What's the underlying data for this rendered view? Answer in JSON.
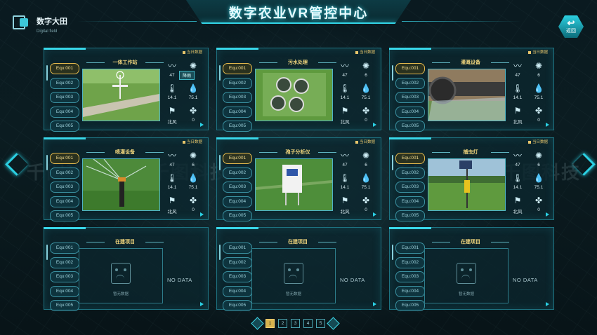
{
  "header": {
    "title": "数字农业VR管控中心",
    "brand_title": "数字大田",
    "brand_sub": "Digital field",
    "back_label": "返回"
  },
  "tooltip": "降雨",
  "panels": [
    {
      "title": "一体工作站",
      "tag": "当日数据",
      "photo": "weather-station",
      "equipment": [
        "Equ:001",
        "Equ:002",
        "Equ:003",
        "Equ:004",
        "Equ:005"
      ],
      "metrics": {
        "humidity": "47",
        "light": "6",
        "temperature": "14.1",
        "moisture": "75.1",
        "wind_direction": "北风",
        "wind_speed": "0"
      }
    },
    {
      "title": "污水处理",
      "tag": "当日数据",
      "photo": "sewage-plant",
      "equipment": [
        "Equ:001",
        "Equ:002",
        "Equ:003",
        "Equ:004",
        "Equ:005"
      ],
      "metrics": {
        "humidity": "47",
        "light": "6",
        "temperature": "14.1",
        "moisture": "75.1",
        "wind_direction": "北风",
        "wind_speed": "0"
      }
    },
    {
      "title": "灌溉设备",
      "tag": "当日数据",
      "photo": "irrigation-machine",
      "equipment": [
        "Equ:001",
        "Equ:002",
        "Equ:003",
        "Equ:004",
        "Equ:005"
      ],
      "metrics": {
        "humidity": "47",
        "light": "6",
        "temperature": "14.1",
        "moisture": "75.1",
        "wind_direction": "北风",
        "wind_speed": "0"
      }
    },
    {
      "title": "喷灌设备",
      "tag": "当日数据",
      "photo": "sprinkler",
      "equipment": [
        "Equ:001",
        "Equ:002",
        "Equ:003",
        "Equ:004",
        "Equ:005"
      ],
      "metrics": {
        "humidity": "47",
        "light": "6",
        "temperature": "14.1",
        "moisture": "75.1",
        "wind_direction": "北风",
        "wind_speed": "0"
      }
    },
    {
      "title": "孢子分析仪",
      "tag": "当日数据",
      "photo": "spore-analyzer",
      "equipment": [
        "Equ:001",
        "Equ:002",
        "Equ:003",
        "Equ:004",
        "Equ:005"
      ],
      "metrics": {
        "humidity": "47",
        "light": "6",
        "temperature": "14.1",
        "moisture": "75.1",
        "wind_direction": "北风",
        "wind_speed": "0"
      }
    },
    {
      "title": "捕虫灯",
      "tag": "当日数据",
      "photo": "insect-lamp",
      "equipment": [
        "Equ:001",
        "Equ:002",
        "Equ:003",
        "Equ:004",
        "Equ:005"
      ],
      "metrics": {
        "humidity": "47",
        "light": "6",
        "temperature": "14.1",
        "moisture": "75.1",
        "wind_direction": "北风",
        "wind_speed": "0"
      }
    },
    {
      "title": "在建项目",
      "tag": "",
      "nodata_caption": "暂无数据",
      "nodata_text": "NO DATA",
      "equipment": [
        "Equ:001",
        "Equ:002",
        "Equ:003",
        "Equ:004",
        "Equ:005"
      ]
    },
    {
      "title": "在建项目",
      "tag": "",
      "nodata_caption": "暂无数据",
      "nodata_text": "NO DATA",
      "equipment": [
        "Equ:001",
        "Equ:002",
        "Equ:003",
        "Equ:004",
        "Equ:005"
      ]
    },
    {
      "title": "在建项目",
      "tag": "",
      "nodata_caption": "暂无数据",
      "nodata_text": "NO DATA",
      "equipment": [
        "Equ:001",
        "Equ:002",
        "Equ:003",
        "Equ:004",
        "Equ:005"
      ]
    }
  ],
  "pagination": {
    "pages": [
      "1",
      "2",
      "3",
      "4",
      "5"
    ],
    "current": "1"
  },
  "watermark": "千图科技",
  "colors": {
    "accent": "#2bd0e3",
    "gold": "#e2b84d",
    "panel_bg": "#0c262e"
  }
}
